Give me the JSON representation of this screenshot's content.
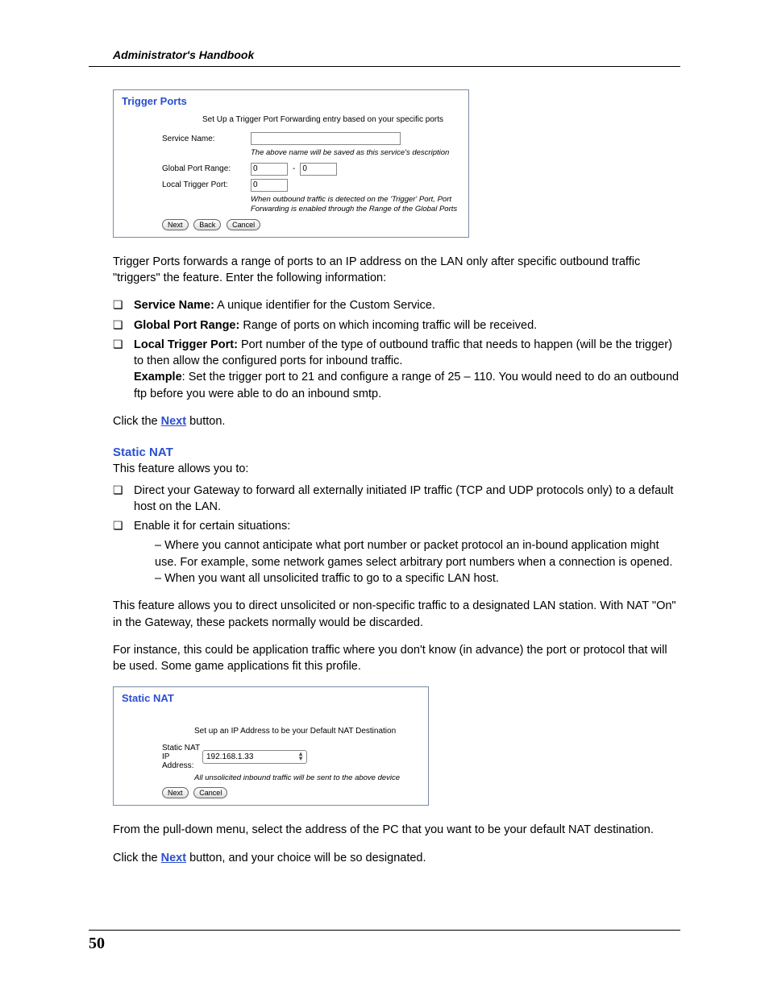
{
  "header": {
    "running_head": "Administrator's Handbook"
  },
  "panel1": {
    "title": "Trigger Ports",
    "subtitle": "Set Up a Trigger Port Forwarding entry based on your specific ports",
    "service_name_label": "Service Name:",
    "service_name_value": "",
    "service_name_hint": "The above name will be saved as this service's description",
    "global_port_label": "Global Port Range:",
    "global_port_start": "0",
    "global_port_sep": "-",
    "global_port_end": "0",
    "local_trigger_label": "Local Trigger Port:",
    "local_trigger_value": "0",
    "trigger_hint": "When outbound traffic is detected on the 'Trigger' Port, Port Forwarding is enabled through the Range of the Global Ports",
    "next_btn": "Next",
    "back_btn": "Back",
    "cancel_btn": "Cancel"
  },
  "text1": "Trigger Ports forwards a range of ports to an IP address on the LAN only after specific outbound traffic \"triggers\" the feature. Enter the following information:",
  "list1": {
    "i0": {
      "label": "Service Name:",
      "text": " A unique identifier for the Custom Service."
    },
    "i1": {
      "label": "Global Port Range:",
      "text": " Range of ports on which incoming traffic will be received."
    },
    "i2": {
      "label": "Local Trigger Port:",
      "text": " Port number of the type of outbound traffic that needs to happen (will be the trigger) to then allow the configured ports for inbound traffic.",
      "ex_label": "Example",
      "ex_text": ": Set the trigger port to 21 and configure a range of 25 – 110. You would need to do an outbound ftp before you were able to do an inbound smtp."
    }
  },
  "click1_pre": "Click the ",
  "click1_link": "Next",
  "click1_post": " button.",
  "sec_head": "Static NAT",
  "text2": "This feature allows you to:",
  "list2": {
    "i0": "Direct your Gateway to forward all externally initiated IP traffic (TCP and UDP protocols only) to a default host on the LAN.",
    "i1": " Enable it for certain situations:",
    "sub0": " – Where you cannot anticipate what port number or packet protocol an in-bound application might use. For example, some network games select arbitrary port numbers when a connection is opened.",
    "sub1": "– When you want all unsolicited traffic to go to a specific LAN host."
  },
  "text3": "This feature allows you to direct unsolicited or non-specific traffic to a designated LAN station. With NAT \"On\" in the Gateway, these packets normally would be discarded.",
  "text4": "For instance, this could be application traffic where you don't know (in advance) the port or protocol that will be used. Some game applications fit this profile.",
  "panel2": {
    "title": "Static NAT",
    "subtitle": "Set up an IP Address to be your Default NAT Destination",
    "nat_label": "Static NAT IP Address:",
    "nat_value": "192.168.1.33",
    "nat_hint": "All unsolicited inbound traffic will be sent to the above device",
    "next_btn": "Next",
    "cancel_btn": "Cancel"
  },
  "text5": "From the pull-down menu, select the address of the PC that you want to be your default NAT destination.",
  "click2_pre": "Click the ",
  "click2_link": "Next",
  "click2_post": " button, and your choice will be so designated.",
  "page_number": "50"
}
